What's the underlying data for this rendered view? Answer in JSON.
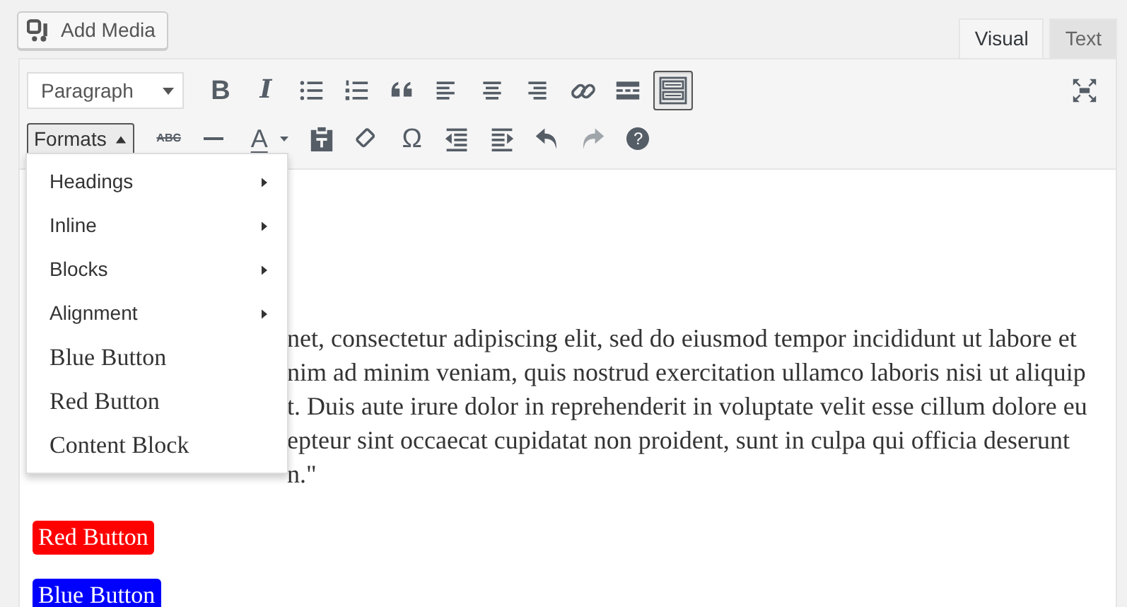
{
  "add_media": {
    "label": "Add Media"
  },
  "tabs": [
    {
      "label": "Visual",
      "selected": true
    },
    {
      "label": "Text",
      "selected": false
    }
  ],
  "toolbar": {
    "block_format": {
      "value": "Paragraph"
    },
    "row_1": [
      {
        "kind": "bold",
        "label": "B",
        "pressed": false,
        "disabled": false
      },
      {
        "kind": "italic",
        "label": "I",
        "pressed": false,
        "disabled": false
      },
      {
        "kind": "bullet-list",
        "pressed": false,
        "disabled": false
      },
      {
        "kind": "numbered-list",
        "pressed": false,
        "disabled": false
      },
      {
        "kind": "quote",
        "pressed": false,
        "disabled": false
      },
      {
        "kind": "align-left",
        "pressed": false,
        "disabled": false
      },
      {
        "kind": "align-center",
        "pressed": false,
        "disabled": false
      },
      {
        "kind": "align-right",
        "pressed": false,
        "disabled": false
      },
      {
        "kind": "link",
        "pressed": false,
        "disabled": false
      },
      {
        "kind": "read-more",
        "pressed": false,
        "disabled": false
      },
      {
        "kind": "keyboard",
        "pressed": true,
        "disabled": false
      }
    ],
    "formats": {
      "label": "Formats",
      "expanded": true
    },
    "row_2": [
      {
        "kind": "strikethrough",
        "label": "ABC",
        "pressed": false,
        "disabled": false
      },
      {
        "kind": "horizontal-line",
        "pressed": false,
        "disabled": false
      },
      {
        "kind": "text-color",
        "label": "A",
        "pressed": false,
        "disabled": false
      },
      {
        "kind": "caret",
        "pressed": false,
        "disabled": false
      },
      {
        "kind": "clipboard",
        "pressed": false,
        "disabled": false
      },
      {
        "kind": "eraser",
        "pressed": false,
        "disabled": false
      },
      {
        "kind": "omega",
        "label": "Ω",
        "pressed": false,
        "disabled": false
      },
      {
        "kind": "outdent",
        "pressed": false,
        "disabled": false
      },
      {
        "kind": "indent",
        "pressed": false,
        "disabled": false
      },
      {
        "kind": "undo",
        "pressed": false,
        "disabled": false
      },
      {
        "kind": "redo",
        "pressed": false,
        "disabled": true
      },
      {
        "kind": "help",
        "label": "?",
        "pressed": false,
        "disabled": false
      }
    ]
  },
  "formats_menu": [
    {
      "label": "Headings",
      "kind": "submenu"
    },
    {
      "label": "Inline",
      "kind": "submenu"
    },
    {
      "label": "Blocks",
      "kind": "submenu"
    },
    {
      "label": "Alignment",
      "kind": "submenu"
    },
    {
      "label": "Blue Button",
      "kind": "style"
    },
    {
      "label": "Red Button",
      "kind": "style"
    },
    {
      "label": "Content Block",
      "kind": "style"
    }
  ],
  "content": {
    "paragraph_lines": [
      "net, consectetur adipiscing elit, sed do eiusmod tempor incididunt ut labore et",
      "nim ad minim veniam, quis nostrud exercitation ullamco laboris nisi ut aliquip",
      "t. Duis aute irure dolor in reprehenderit in voluptate velit esse cillum dolore eu",
      "epteur sint occaecat cupidatat non proident, sunt in culpa qui officia deserunt",
      "n.\""
    ],
    "buttons": [
      {
        "label": "Red Button",
        "color": "#ff0000"
      },
      {
        "label": "Blue Button",
        "color": "#0000ff"
      }
    ]
  }
}
